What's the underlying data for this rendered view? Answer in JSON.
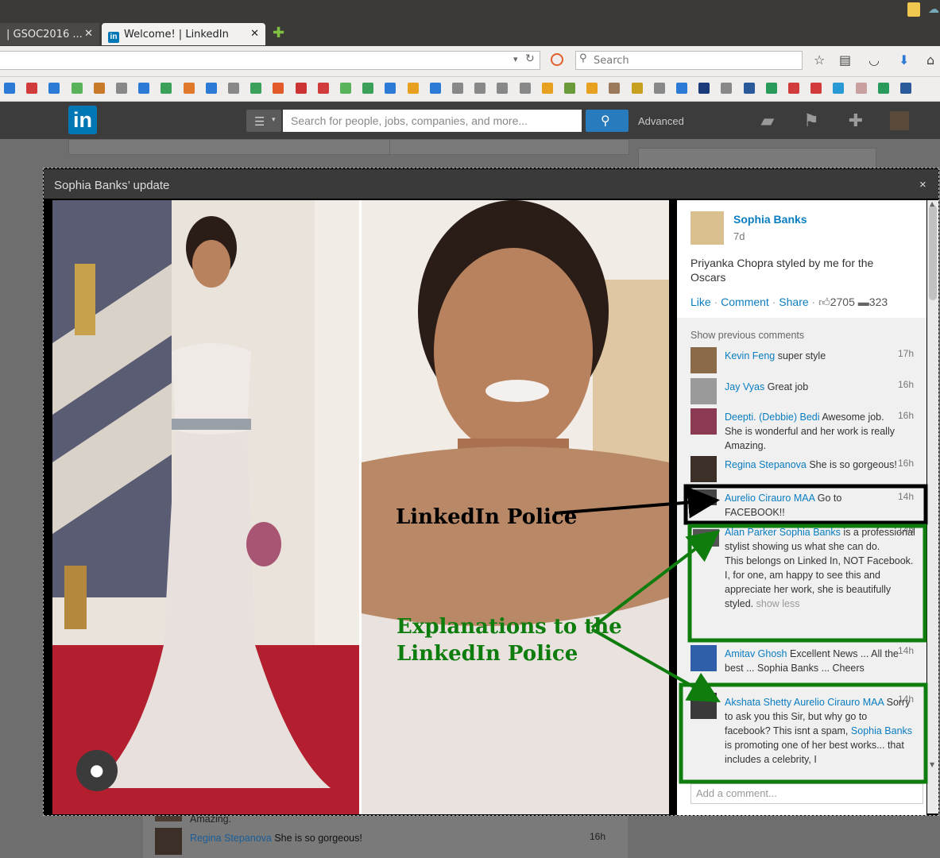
{
  "browser": {
    "tabs": [
      {
        "label": "| GSOC2016 ..."
      },
      {
        "label": "Welcome! | LinkedIn"
      }
    ],
    "tab_close_glyph": "✕",
    "new_tab_glyph": "✚",
    "search_placeholder": "Search"
  },
  "linkedin_header": {
    "logo": "in",
    "search_placeholder": "Search for people, jobs, companies, and more...",
    "advanced_label": "Advanced"
  },
  "modal": {
    "title": "Sophia Banks’ update",
    "close": "×",
    "post": {
      "author": "Sophia Banks",
      "age": "7d",
      "text": "Priyanka Chopra styled by me for the Oscars",
      "actions": {
        "like": "Like",
        "comment": "Comment",
        "share": "Share"
      },
      "likes": "2705",
      "comments": "323"
    },
    "show_previous": "Show previous comments",
    "comments": [
      {
        "name": "Kevin Feng",
        "text": "super style",
        "time": "17h",
        "avatar_color": "#8b6a4a"
      },
      {
        "name": "Jay Vyas",
        "text": "Great job",
        "time": "16h",
        "avatar_color": "#9a9a9a"
      },
      {
        "name": "Deepti. (Debbie) Bedi",
        "text": "Awesome job. She is wonderful and her work is really Amazing.",
        "time": "16h",
        "avatar_color": "#8a3b52"
      },
      {
        "name": "Regina Stepanova",
        "text": "She is so gorgeous!",
        "time": "16h",
        "avatar_color": "#3b2f28"
      },
      {
        "name": "Aurelio Cirauro MAA",
        "text": "Go to FACEBOOK!!",
        "time": "14h",
        "avatar_color": "#444444"
      },
      {
        "name": "Alan Parker",
        "mention": "Sophia Banks",
        "text": "is a professional stylist showing us what she can do.\nThis belongs on Linked In, NOT Facebook.\nI, for one, am happy to see this and appreciate her work, she is beautifully styled.",
        "more": "show less",
        "time": "14h",
        "avatar_color": "#555555"
      },
      {
        "name": "Amitav Ghosh",
        "text": "Excellent News ... All the best ... Sophia Banks ... Cheers",
        "time": "14h",
        "avatar_color": "#2f5fa8"
      },
      {
        "name": "Akshata Shetty",
        "mention": "Aurelio Cirauro MAA",
        "text": "Sorry to ask you this Sir, but why go to facebook? This isnt a spam,",
        "mention2": "Sophia Banks",
        "text2": "is promoting one of her best works... that includes a celebrity, I",
        "time": "14h",
        "avatar_color": "#3a3a3a"
      }
    ],
    "add_comment_placeholder": "Add a comment..."
  },
  "annotations": {
    "police_label": "LinkedIn Police",
    "explain_line1": "Explanations to the",
    "explain_line2": "LinkedIn Police",
    "police_color": "#000000",
    "explain_color": "#0e7d0e"
  },
  "below_feed": {
    "fragment_text": "Amazing.",
    "name": "Regina Stepanova",
    "text": "She is so gorgeous!",
    "time": "16h"
  }
}
